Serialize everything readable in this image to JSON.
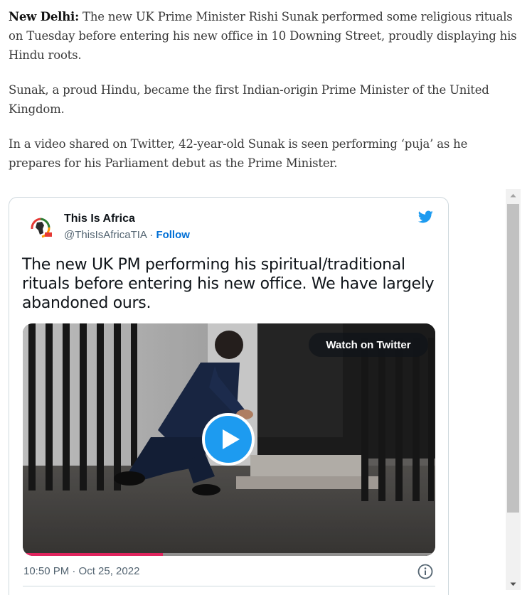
{
  "article": {
    "p1_lead": "New Delhi:",
    "p1_text": " The new UK Prime Minister Rishi Sunak performed some religious rituals on Tuesday before entering his new office in 10 Downing Street, proudly displaying his Hindu roots.",
    "p2_text": "Sunak, a proud Hindu, became the first Indian-origin Prime Minister of the United Kingdom.",
    "p3_text": "In a video shared on Twitter, 42-year-old Sunak is seen performing ‘puja’ as he prepares for his Parliament debut as the Prime Minister."
  },
  "tweet": {
    "author_name": "This Is Africa",
    "handle": "@ThisIsAfricaTIA",
    "separator": " · ",
    "follow_label": "Follow",
    "text": "The new UK PM performing his spiritual/traditional rituals before entering his new office. We have largely abandoned ours.",
    "media": {
      "watch_label": "Watch on Twitter",
      "progress": 0.34
    },
    "timestamp": "10:50 PM · Oct 25, 2022"
  },
  "colors": {
    "twitter_blue": "#1d9bf0",
    "follow_blue": "#006fd6",
    "progress_red": "#e0245e"
  },
  "icons": {
    "logo": "twitter-bird-icon",
    "play": "play-icon",
    "info": "info-icon"
  }
}
